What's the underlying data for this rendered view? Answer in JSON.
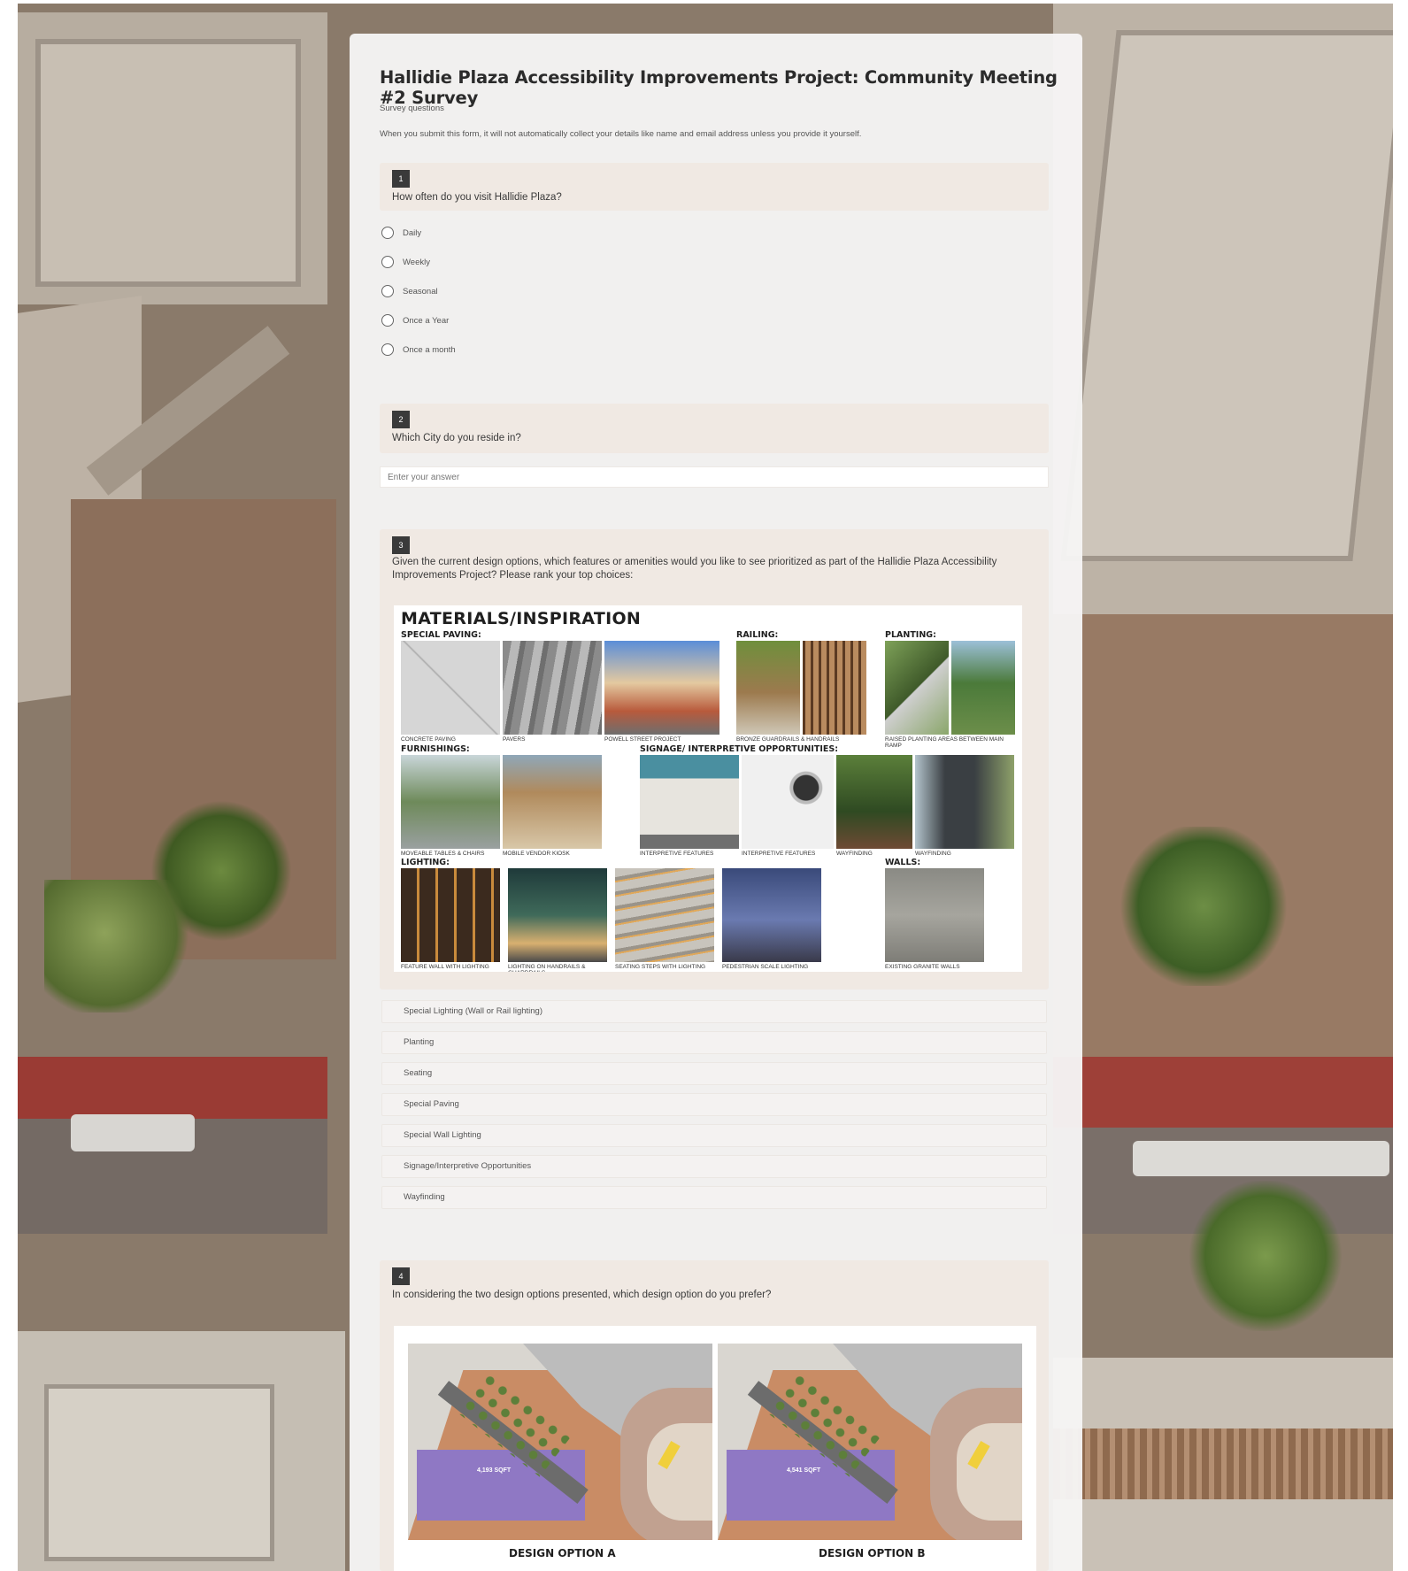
{
  "survey": {
    "title": "Hallidie Plaza Accessibility Improvements Project: Community Meeting #2 Survey",
    "subtitle": "Survey questions",
    "notice": "When you submit this form, it will not automatically collect your details like name and email address unless you provide it yourself."
  },
  "questions": [
    {
      "number": "1",
      "text": "How often do you visit Hallidie Plaza?",
      "options": [
        "Daily",
        "Weekly",
        "Seasonal",
        "Once a Year",
        "Once a month"
      ]
    },
    {
      "number": "2",
      "text": "Which City do you reside in?",
      "placeholder": "Enter your answer"
    },
    {
      "number": "3",
      "text": "Given the current design options, which features or amenities would you like to see prioritized as part of the Hallidie Plaza Accessibility Improvements Project? Please rank your top choices:",
      "rank_items": [
        "Special Lighting (Wall or Rail lighting)",
        "Planting",
        "Seating",
        "Special Paving",
        "Special Wall Lighting",
        "Signage/Interpretive Opportunities",
        "Wayfinding"
      ]
    },
    {
      "number": "4",
      "text": "In considering the two design options presented, which design option do you prefer?"
    }
  ],
  "inspiration_board": {
    "title": "MATERIALS/INSPIRATION",
    "headings": {
      "special_paving": "SPECIAL PAVING:",
      "railing": "RAILING:",
      "planting": "PLANTING:",
      "furnishings": "FURNISHINGS:",
      "signage": "SIGNAGE/ INTERPRETIVE OPPORTUNITIES:",
      "lighting": "LIGHTING:",
      "walls": "WALLS:"
    },
    "captions": {
      "concrete_paving": "CONCRETE PAVING",
      "pavers": "PAVERS",
      "powell_street": "POWELL STREET PROJECT",
      "bronze_guardrails": "BRONZE GUARDRAILS & HANDRAILS",
      "raised_planting": "RAISED PLANTING AREAS BETWEEN MAIN RAMP",
      "movable_tables": "MOVEABLE TABLES & CHAIRS",
      "vendor_kiosk": "MOBILE VENDOR KIOSK",
      "interpretive_1": "INTERPRETIVE FEATURES",
      "interpretive_2": "INTERPRETIVE FEATURES",
      "wayfinding_1": "WAYFINDING",
      "wayfinding_2": "WAYFINDING",
      "feature_wall": "FEATURE WALL WITH LIGHTING",
      "handrail_lighting": "LIGHTING ON HANDRAILS & GUARDRAILS",
      "seating_steps": "SEATING STEPS WITH LIGHTING",
      "pedestrian_lighting": "PEDESTRIAN SCALE LIGHTING",
      "granite_walls": "EXISTING GRANITE WALLS"
    }
  },
  "design_options": {
    "option_a": {
      "label": "DESIGN OPTION A",
      "area": "4,193 SQFT"
    },
    "option_b": {
      "label": "DESIGN OPTION B",
      "area": "4,541 SQFT"
    }
  }
}
